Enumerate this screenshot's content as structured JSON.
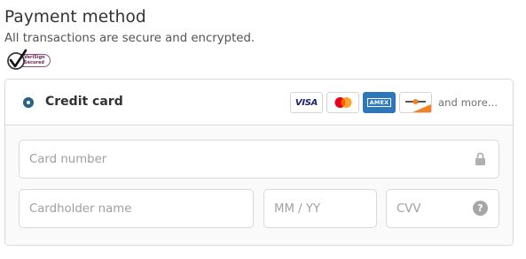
{
  "header": {
    "title": "Payment method",
    "subtitle": "All transactions are secure and encrypted."
  },
  "badge": {
    "text_line1": "VeriSign",
    "text_line2": "Secured",
    "icon": "verisign-check-icon"
  },
  "payment_option": {
    "label": "Credit card",
    "selected": true,
    "cards": [
      {
        "name": "visa",
        "label": "VISA"
      },
      {
        "name": "mastercard",
        "label": ""
      },
      {
        "name": "amex",
        "label": "AMEX"
      },
      {
        "name": "discover",
        "label": ""
      }
    ],
    "more_label": "and more..."
  },
  "form": {
    "card_number_placeholder": "Card number",
    "cardholder_placeholder": "Cardholder name",
    "expiry_placeholder": "MM / YY",
    "cvv_placeholder": "CVV",
    "help_glyph": "?"
  },
  "colors": {
    "radio": "#2c5e8f",
    "amex_bg": "#2e77bb",
    "visa_text": "#1a1f71",
    "mastercard_red": "#eb001b",
    "mastercard_orange": "#f79e1b",
    "badge": "#8e4a78"
  }
}
